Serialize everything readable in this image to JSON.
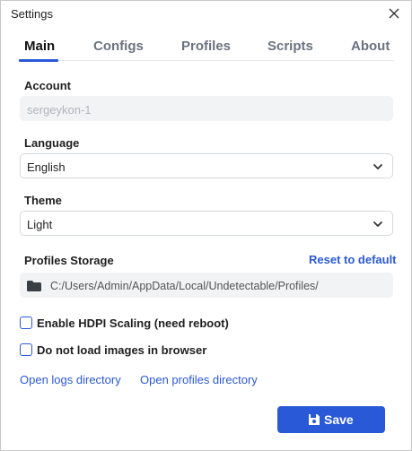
{
  "window": {
    "title": "Settings"
  },
  "tabs": [
    {
      "label": "Main",
      "active": true
    },
    {
      "label": "Configs",
      "active": false
    },
    {
      "label": "Profiles",
      "active": false
    },
    {
      "label": "Scripts",
      "active": false
    },
    {
      "label": "About",
      "active": false
    }
  ],
  "account": {
    "label": "Account",
    "value": "sergeykon-1"
  },
  "language": {
    "label": "Language",
    "value": "English"
  },
  "theme": {
    "label": "Theme",
    "value": "Light"
  },
  "storage": {
    "label": "Profiles Storage",
    "reset_label": "Reset to default",
    "path": "C:/Users/Admin/AppData/Local/Undetectable/Profiles/"
  },
  "options": [
    {
      "label": "Enable HDPI Scaling (need reboot)",
      "checked": false
    },
    {
      "label": "Do not load images in browser",
      "checked": false
    }
  ],
  "links": {
    "logs": "Open logs directory",
    "profiles": "Open profiles directory"
  },
  "save_label": "Save",
  "colors": {
    "accent": "#2a59d8",
    "muted": "#6b7280",
    "disabled_bg": "#f1f3f5"
  },
  "icons": {
    "close": "close-icon",
    "chevron": "chevron-down-icon",
    "folder": "folder-icon",
    "save": "floppy-disk-icon"
  }
}
